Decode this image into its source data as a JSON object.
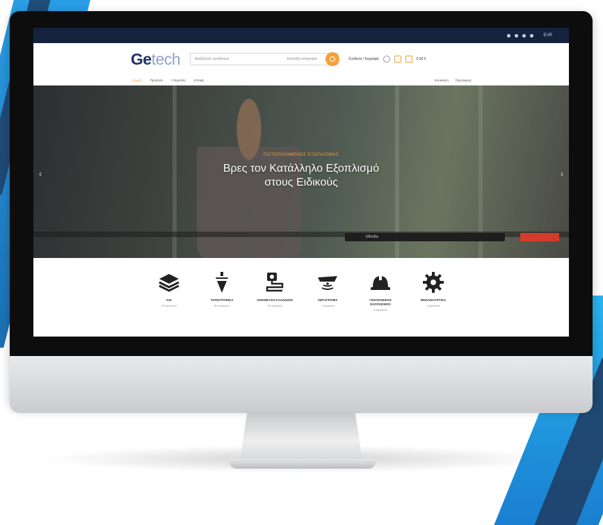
{
  "site": {
    "logo_main": "Ge",
    "logo_light": "tech",
    "search_placeholder": "Αναζήτηση προϊόντων",
    "search_category": "Επιλέξτε κατηγορία",
    "account_label": "Σύνδεση / Εγγραφή",
    "cart_label": "0,00 €",
    "topbar_lang": "EUR"
  },
  "nav": {
    "items": [
      "Αρχική",
      "Προϊόντα",
      "Υπηρεσίες",
      "Επαφή"
    ],
    "right_items": [
      "Ενοικίαση",
      "Προσφορές"
    ]
  },
  "hero": {
    "subtitle": "ΠΙΣΤΟΠΟΙΗΜΕΝΟΣ ΕΞΟΠΛΙΣΜΟΣ",
    "title_line1": "Βρες τον Κατάλληλο Εξοπλισμό",
    "title_line2": "στους Ειδικούς",
    "arrow_left": "‹",
    "arrow_right": "›",
    "device_label": "Mirella"
  },
  "categories": [
    {
      "icon": "layers-icon",
      "name": "GIS",
      "count": "23 προϊόντα"
    },
    {
      "icon": "plumb-bob-icon",
      "name": "ΤΟΠΟΓΡΑΦΙΚΑ",
      "count": "80 προϊόντα"
    },
    {
      "icon": "cable-locator-icon",
      "name": "ΑΝΙΧΝΕΥΣΗ ΚΑΛΩΔΙΩΝ",
      "count": "76 προϊόντα"
    },
    {
      "icon": "sonar-boat-icon",
      "name": "ΥΔΡΟΓΡΑΦΙΑ",
      "count": "7 προϊόντα"
    },
    {
      "icon": "hard-hat-icon",
      "name": "ΓΕΩΤΕΧΝΙΚΟΣ ΕΞΟΠΛΙΣΜΟΣ",
      "count": "3 προϊόντα"
    },
    {
      "icon": "gear-icon",
      "name": "ΜΗΧΑΝΟΥΡΓΙΚΑ",
      "count": "2 προϊόντα"
    }
  ],
  "colors": {
    "accent": "#f3a13a",
    "navy": "#1e2f6b",
    "topbar": "#14223e",
    "deco_blue": "#1f8ee0"
  }
}
